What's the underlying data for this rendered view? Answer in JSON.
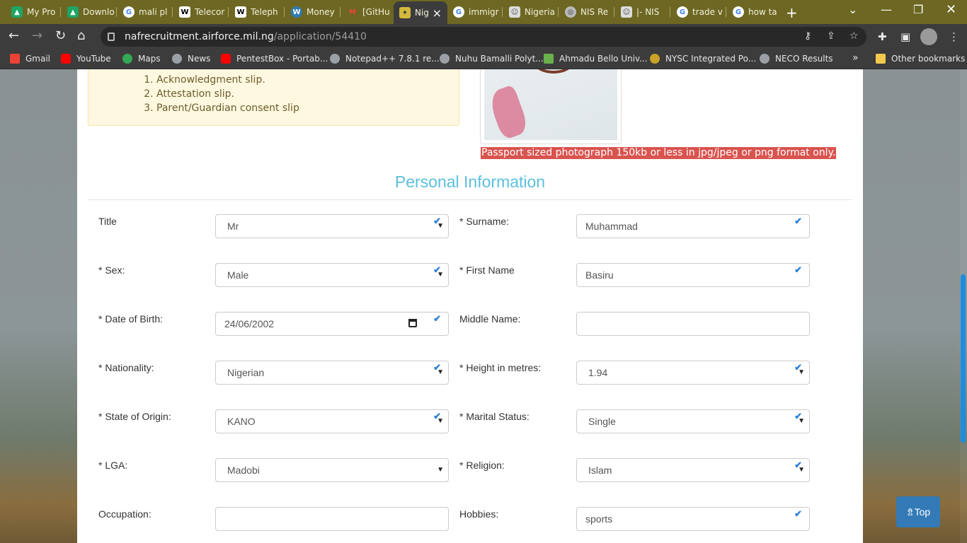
{
  "tabs": [
    {
      "label": "My Pro",
      "icon": "drive-icon",
      "color": "#1fa463"
    },
    {
      "label": "Downlo",
      "icon": "drive-icon",
      "color": "#1fa463"
    },
    {
      "label": "mali pl",
      "icon": "google-icon",
      "color": "#ffffff"
    },
    {
      "label": "Telecor",
      "icon": "wikipedia-icon",
      "color": "#ffffff"
    },
    {
      "label": "Teleph",
      "icon": "wikipedia-icon",
      "color": "#ffffff"
    },
    {
      "label": "Money",
      "icon": "wordpress-icon",
      "color": "#2e7bb5"
    },
    {
      "label": "[GitHu",
      "icon": "gmail-icon",
      "color": "#ea4335"
    },
    {
      "label": "Nig",
      "icon": "airforce-icon",
      "color": "#d4b93a"
    },
    {
      "label": "immigr",
      "icon": "google-icon",
      "color": "#ffffff"
    },
    {
      "label": "Nigeria",
      "icon": "portrait-icon",
      "color": "#dddddd"
    },
    {
      "label": "NIS Re",
      "icon": "globe-icon",
      "color": "#bbbbbb"
    },
    {
      "label": "|- NIS",
      "icon": "portrait-icon",
      "color": "#dddddd"
    },
    {
      "label": "trade v",
      "icon": "google-icon",
      "color": "#ffffff"
    },
    {
      "label": "how ta",
      "icon": "google-icon",
      "color": "#ffffff"
    }
  ],
  "address": {
    "host": "nafrecruitment.airforce.mil.ng",
    "path": "/application/54410"
  },
  "bookmarks": [
    {
      "label": "Gmail",
      "color": "#ea4335"
    },
    {
      "label": "YouTube",
      "color": "#ff0000"
    },
    {
      "label": "Maps",
      "color": "#34a853"
    },
    {
      "label": "News",
      "color": "#9aa0a6"
    },
    {
      "label": "PentestBox - Portab...",
      "color": "#ff0000"
    },
    {
      "label": "Notepad++ 7.8.1 re...",
      "color": "#9aa0a6"
    },
    {
      "label": "Nuhu Bamalli Polyt...",
      "color": "#9aa0a6"
    },
    {
      "label": "Ahmadu Bello Univ...",
      "color": "#6ab04c"
    },
    {
      "label": "NYSC Integrated Po...",
      "color": "#c9a227"
    },
    {
      "label": "NECO Results",
      "color": "#9aa0a6"
    }
  ],
  "bookmarks_overflow": "»",
  "other_bookmarks": "Other bookmarks",
  "notice": {
    "items": [
      "Acknowledgment slip.",
      "Attestation slip.",
      "Parent/Guardian consent slip"
    ]
  },
  "photo_note": "Passport sized photograph 150kb or less in jpg/jpeg or png format only.",
  "section_title": "Personal Information",
  "form": {
    "title_label": "Title",
    "title_value": "Mr",
    "surname_label": "* Surname:",
    "surname_value": "Muhammad",
    "sex_label": "* Sex:",
    "sex_value": "Male",
    "firstname_label": "* First Name",
    "firstname_value": "Basiru",
    "dob_label": "* Date of Birth:",
    "dob_value": "24/06/2002",
    "middlename_label": "Middle Name:",
    "middlename_value": "",
    "nationality_label": "* Nationality:",
    "nationality_value": "Nigerian",
    "height_label": "* Height in metres:",
    "height_value": "1.94",
    "state_label": "* State of Origin:",
    "state_value": "KANO",
    "marital_label": "* Marital Status:",
    "marital_value": "Single",
    "lga_label": "* LGA:",
    "lga_value": "Madobi",
    "religion_label": "* Religion:",
    "religion_value": "Islam",
    "occupation_label": "Occupation:",
    "occupation_value": "",
    "hobbies_label": "Hobbies:",
    "hobbies_value": "sports"
  },
  "top_button": "⇯Top",
  "colors": {
    "accent": "#5bc0de",
    "danger": "#d9534f",
    "primary": "#337ab7",
    "valid": "#2a7fd8"
  }
}
